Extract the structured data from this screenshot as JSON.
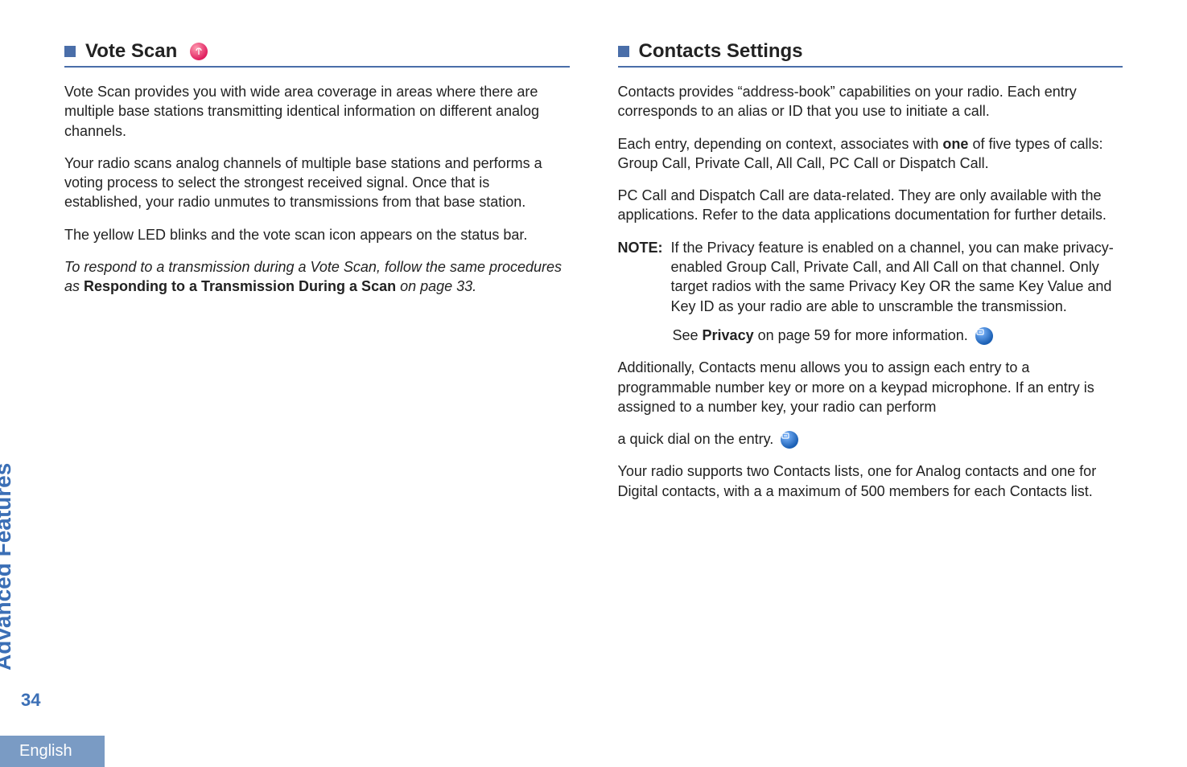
{
  "left": {
    "title": "Vote Scan",
    "pink_icon": "antenna-icon",
    "p1": "Vote Scan provides you with wide area coverage in areas where there are multiple base stations transmitting identical information on different analog channels.",
    "p2": "Your radio scans analog channels of multiple base stations and performs a voting process to select the strongest received signal. Once that is established, your radio unmutes to transmissions from that base station.",
    "p3": "The yellow LED blinks and the vote scan icon appears on the status bar.",
    "p4_italic": "To respond to a transmission during a Vote Scan, follow the same procedures as ",
    "p4_bold": "Responding to a Transmission During a Scan",
    "p4_tail_italic": " on page 33."
  },
  "right": {
    "title": "Contacts Settings",
    "p1": "Contacts provides “address-book” capabilities on your radio. Each entry corresponds to an alias or ID that you use to initiate a call.",
    "p2a": "Each entry, depending on context, associates with ",
    "p2_bold": "one",
    "p2b": " of five types of calls: Group Call, Private Call, All Call, PC Call or Dispatch Call.",
    "p3": "PC Call and Dispatch Call are data-related. They are only available with the applications. Refer to the data applications documentation for further details.",
    "note_label": "NOTE:",
    "note_body": "If the Privacy feature is enabled on a channel, you can make privacy-enabled Group Call, Private Call, and All Call on that channel. Only target radios with the same Privacy Key OR the same Key Value and Key ID as your radio are able to unscramble the transmission.",
    "note_sub_a": "See ",
    "note_sub_bold": "Privacy",
    "note_sub_b": " on page 59 for more information. ",
    "blue_icon": "digital-icon",
    "p4": "Additionally, Contacts menu allows you to assign each entry to a programmable number key or more on a keypad microphone. If an entry is assigned to a number key, your radio can perform",
    "p5": "a quick dial on the entry. ",
    "p6": "Your radio supports two Contacts lists, one for Analog contacts and one for Digital contacts, with a a maximum of 500 members for each Contacts list."
  },
  "side_label": "Advanced Features",
  "page_num": "34",
  "lang": "English"
}
